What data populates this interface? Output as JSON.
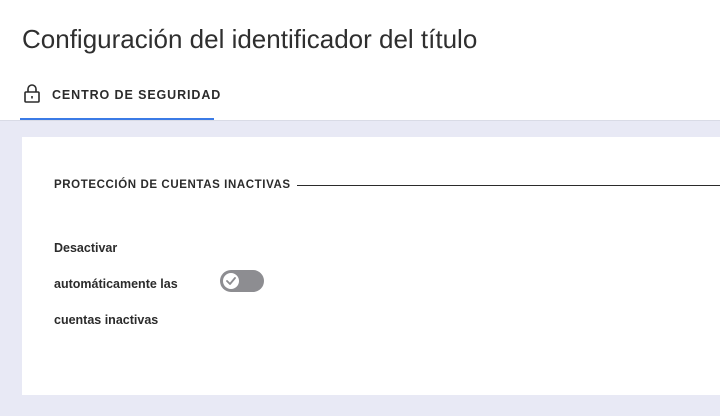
{
  "page": {
    "title": "Configuración del identificador del título"
  },
  "tabs": [
    {
      "label": "CENTRO DE SEGURIDAD",
      "icon": "lock-icon",
      "active": true
    }
  ],
  "section": {
    "title": "PROTECCIÓN DE CUENTAS INACTIVAS",
    "setting": {
      "label_lines": [
        "Desactivar",
        "automáticamente las",
        "cuentas inactivas"
      ],
      "toggle": {
        "state": "off",
        "icon": "check-icon"
      }
    }
  },
  "colors": {
    "accent": "#3b7be6",
    "background": "#e8e9f5",
    "toggle_off": "#8d8d91",
    "text": "#2b2b2b"
  }
}
